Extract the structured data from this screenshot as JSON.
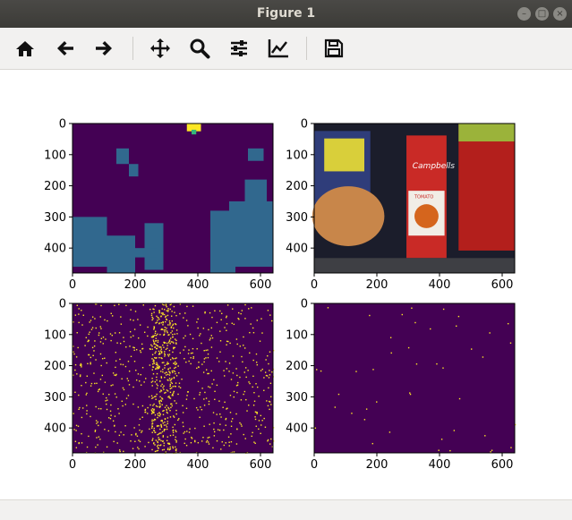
{
  "window": {
    "title": "Figure 1"
  },
  "toolbar": {
    "buttons": [
      {
        "name": "home-icon",
        "tooltip": "Home"
      },
      {
        "name": "back-arrow-icon",
        "tooltip": "Back"
      },
      {
        "name": "forward-arrow-icon",
        "tooltip": "Forward"
      },
      {
        "name": "pan-icon",
        "tooltip": "Pan"
      },
      {
        "name": "zoom-icon",
        "tooltip": "Zoom"
      },
      {
        "name": "subplots-icon",
        "tooltip": "Subplots"
      },
      {
        "name": "edit-axes-icon",
        "tooltip": "Customize"
      },
      {
        "name": "save-icon",
        "tooltip": "Save"
      }
    ]
  },
  "axes": {
    "x_ticks": [
      "0",
      "200",
      "400",
      "600"
    ],
    "y_ticks": [
      "0",
      "100",
      "200",
      "300",
      "400"
    ]
  },
  "colors": {
    "viridis_dark": "#440154",
    "viridis_teal": "#31688e",
    "viridis_yellow": "#fde725",
    "viridis_green": "#35b779"
  },
  "chart_data": [
    {
      "type": "heatmap",
      "title": "",
      "xlim": [
        0,
        640
      ],
      "ylim": [
        480,
        0
      ],
      "colormap": "viridis",
      "description_regions": "mostly dark, teal regions lower-left and lower-right, small yellow patch near top"
    },
    {
      "type": "image",
      "title": "",
      "xlim": [
        0,
        640
      ],
      "ylim": [
        480,
        0
      ],
      "content": "photo of cans and a burger on a table",
      "visible_text": [
        "Campbells",
        "TOMATO"
      ]
    },
    {
      "type": "heatmap",
      "title": "",
      "xlim": [
        0,
        640
      ],
      "ylim": [
        480,
        0
      ],
      "colormap": "viridis",
      "description_regions": "dense yellow edge points on dark background"
    },
    {
      "type": "heatmap",
      "title": "",
      "xlim": [
        0,
        640
      ],
      "ylim": [
        480,
        0
      ],
      "colormap": "viridis",
      "description_regions": "sparse yellow points on dark background"
    }
  ]
}
